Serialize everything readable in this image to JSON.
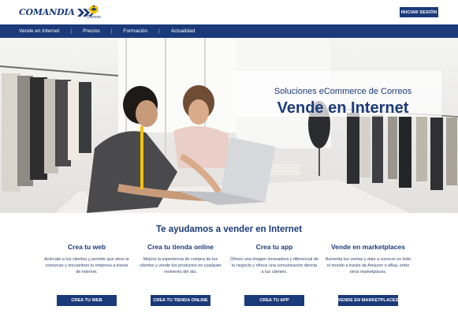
{
  "header": {
    "logo_text": "COMANDIA",
    "correos_text": "Correos",
    "login_label": "INICIAR SESIÓN"
  },
  "nav": {
    "items": [
      "Vende en Internet",
      "Precios",
      "Formación",
      "Actualidad"
    ],
    "separator": "|"
  },
  "hero": {
    "subtitle": "Soluciones eCommerce de Correos",
    "title": "Vende en Internet"
  },
  "section": {
    "title": "Te ayudamos a vender en Internet",
    "columns": [
      {
        "title": "Crea tu web",
        "description": "Acércate a tus clientes y permite que otros te conozcan y encuentren tu empresa a través de Internet.",
        "button": "CREA TU WEB"
      },
      {
        "title": "Crea tu tienda online",
        "description": "Mejora la experiencia de compra de tus clientes y vende tus productos en cualquier momento del día.",
        "button": "CREA TU TIENDA ONLINE"
      },
      {
        "title": "Crea tu app",
        "description": "Ofrece una imagen innovadora y diferencial de tu negocio y ofrece una comunicación directa a tus clientes.",
        "button": "CREA TU APP"
      },
      {
        "title": "Vende en marketplaces",
        "description": "Aumenta tus ventas y date a conocer en todo el mundo a través de Amazon o eBay, entre otros marketplaces.",
        "button": "VENDE EN MARKETPLACES"
      }
    ]
  },
  "colors": {
    "brand": "#1b3a7a",
    "accent_yellow": "#f2c200"
  },
  "icons": {
    "logo_chevrons": "chevron-right-icon",
    "correos_logo": "posthorn-icon"
  }
}
